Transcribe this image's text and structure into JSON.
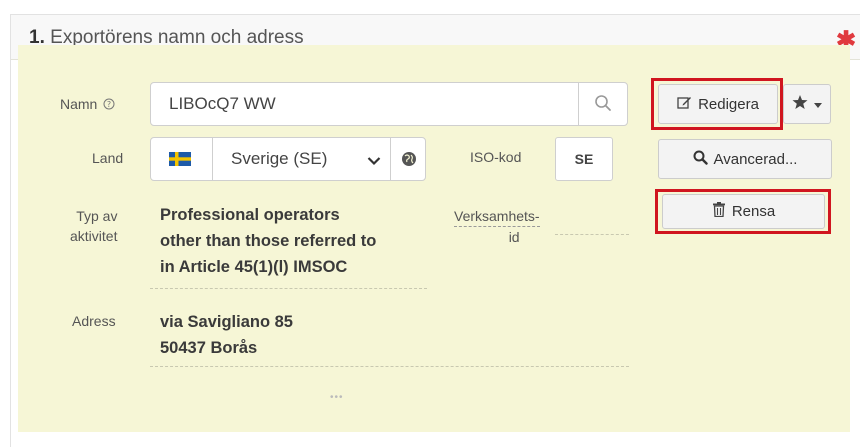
{
  "section": {
    "number": "1.",
    "title": "Exportörens namn och adress",
    "required_mark": "✱"
  },
  "fields": {
    "namn": {
      "label": "Namn",
      "help_icon": "question-circle-icon",
      "value": "LIBOcQ7 WW",
      "search_icon": "search-icon"
    },
    "land": {
      "label": "Land",
      "flag_icon": "sweden-flag-icon",
      "selected": "Sverige (SE)",
      "chevron_icon": "chevron-down-icon",
      "globe_icon": "globe-icon"
    },
    "iso": {
      "label": "ISO-kod",
      "value": "SE"
    },
    "typ_av_aktivitet": {
      "label_line1": "Typ av",
      "label_line2": "aktivitet",
      "value_line1": "Professional operators",
      "value_line2": "other than those referred to",
      "value_line3": "in Article 45(1)(l) IMSOC"
    },
    "verksamhets_id": {
      "label_line1": "Verksamhets-",
      "label_line2": "id",
      "value": ""
    },
    "adress": {
      "label": "Adress",
      "line1": "via Savigliano 85",
      "line2": "50437 Borås"
    },
    "more": "•••"
  },
  "buttons": {
    "redigera": {
      "label": "Redigera",
      "icon": "edit-icon",
      "highlighted": true
    },
    "favorites": {
      "icon": "star-icon",
      "caret_icon": "caret-down-icon"
    },
    "avancerad": {
      "label": "Avancerad...",
      "icon": "search-icon"
    },
    "rensa": {
      "label": "Rensa",
      "icon": "trash-icon",
      "highlighted": true
    }
  },
  "colors": {
    "panel_background": "#f6f6d6",
    "highlight": "#d0151f",
    "required": "#e0393e"
  }
}
